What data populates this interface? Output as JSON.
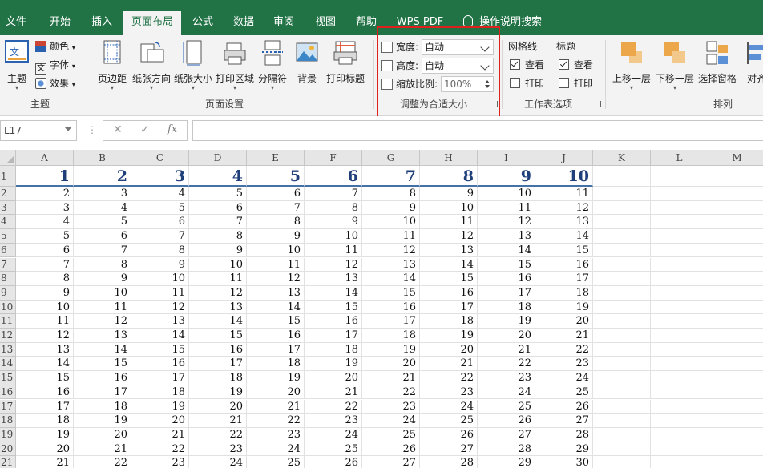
{
  "tabs": [
    "文件",
    "开始",
    "插入",
    "页面布局",
    "公式",
    "数据",
    "审阅",
    "视图",
    "帮助",
    "WPS PDF"
  ],
  "active_tab": "页面布局",
  "tell_me": "操作说明搜索",
  "ribbon": {
    "theme_group": {
      "theme": "主题",
      "colors": "颜色",
      "fonts": "字体",
      "effects": "效果",
      "label": "主题"
    },
    "page_setup": {
      "margins": "页边距",
      "orientation": "纸张方向",
      "size": "纸张大小",
      "print_area": "打印区域",
      "breaks": "分隔符",
      "background": "背景",
      "print_titles": "打印标题",
      "label": "页面设置"
    },
    "scale": {
      "width_label": "宽度:",
      "width_value": "自动",
      "height_label": "高度:",
      "height_value": "自动",
      "scale_label": "缩放比例:",
      "scale_value": "100%",
      "label": "调整为合适大小"
    },
    "sheet_options": {
      "gridlines": "网格线",
      "headings": "标题",
      "view": "查看",
      "print": "打印",
      "label": "工作表选项",
      "gridlines_view": true,
      "gridlines_print": false,
      "headings_view": true,
      "headings_print": false
    },
    "arrange": {
      "bring_forward": "上移一层",
      "send_backward": "下移一层",
      "selection_pane": "选择窗格",
      "align": "对齐",
      "label": "排列"
    }
  },
  "formula_bar": {
    "name_box": "L17",
    "value": ""
  },
  "columns": [
    "A",
    "B",
    "C",
    "D",
    "E",
    "F",
    "G",
    "H",
    "I",
    "J",
    "K",
    "L",
    "M"
  ],
  "rows": [
    "1",
    "2",
    "3",
    "4",
    "5",
    "6",
    "7",
    "8",
    "9",
    "10",
    "11",
    "12",
    "13",
    "14",
    "15",
    "16",
    "17",
    "18",
    "19",
    "20",
    "21"
  ],
  "cells": [
    [
      "1",
      "2",
      "3",
      "4",
      "5",
      "6",
      "7",
      "8",
      "9",
      "10"
    ],
    [
      "2",
      "3",
      "4",
      "5",
      "6",
      "7",
      "8",
      "9",
      "10",
      "11"
    ],
    [
      "3",
      "4",
      "5",
      "6",
      "7",
      "8",
      "9",
      "10",
      "11",
      "12"
    ],
    [
      "4",
      "5",
      "6",
      "7",
      "8",
      "9",
      "10",
      "11",
      "12",
      "13"
    ],
    [
      "5",
      "6",
      "7",
      "8",
      "9",
      "10",
      "11",
      "12",
      "13",
      "14"
    ],
    [
      "6",
      "7",
      "8",
      "9",
      "10",
      "11",
      "12",
      "13",
      "14",
      "15"
    ],
    [
      "7",
      "8",
      "9",
      "10",
      "11",
      "12",
      "13",
      "14",
      "15",
      "16"
    ],
    [
      "8",
      "9",
      "10",
      "11",
      "12",
      "13",
      "14",
      "15",
      "16",
      "17"
    ],
    [
      "9",
      "10",
      "11",
      "12",
      "13",
      "14",
      "15",
      "16",
      "17",
      "18"
    ],
    [
      "10",
      "11",
      "12",
      "13",
      "14",
      "15",
      "16",
      "17",
      "18",
      "19"
    ],
    [
      "11",
      "12",
      "13",
      "14",
      "15",
      "16",
      "17",
      "18",
      "19",
      "20"
    ],
    [
      "12",
      "13",
      "14",
      "15",
      "16",
      "17",
      "18",
      "19",
      "20",
      "21"
    ],
    [
      "13",
      "14",
      "15",
      "16",
      "17",
      "18",
      "19",
      "20",
      "21",
      "22"
    ],
    [
      "14",
      "15",
      "16",
      "17",
      "18",
      "19",
      "20",
      "21",
      "22",
      "23"
    ],
    [
      "15",
      "16",
      "17",
      "18",
      "19",
      "20",
      "21",
      "22",
      "23",
      "24"
    ],
    [
      "16",
      "17",
      "18",
      "19",
      "20",
      "21",
      "22",
      "23",
      "24",
      "25"
    ],
    [
      "17",
      "18",
      "19",
      "20",
      "21",
      "22",
      "23",
      "24",
      "25",
      "26"
    ],
    [
      "18",
      "19",
      "20",
      "21",
      "22",
      "23",
      "24",
      "25",
      "26",
      "27"
    ],
    [
      "19",
      "20",
      "21",
      "22",
      "23",
      "24",
      "25",
      "26",
      "27",
      "28"
    ],
    [
      "20",
      "21",
      "22",
      "23",
      "24",
      "25",
      "26",
      "27",
      "28",
      "29"
    ],
    [
      "21",
      "22",
      "23",
      "24",
      "25",
      "26",
      "27",
      "28",
      "29",
      "30"
    ]
  ],
  "colors": {
    "brand": "#217346",
    "highlight": "#e0201c",
    "header_text": "#1f3f7a"
  }
}
